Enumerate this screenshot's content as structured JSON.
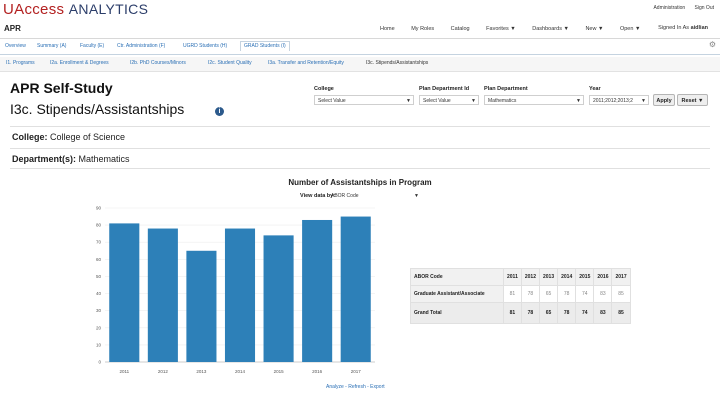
{
  "brand": {
    "u": "U",
    "access": "Access",
    "analytics": "ANALYTICS"
  },
  "top_links": [
    "Administration",
    "Sign Out"
  ],
  "app": {
    "name": "APR"
  },
  "nav": {
    "items": [
      "Home",
      "My Roles",
      "Catalog",
      "Favorites ▼",
      "Dashboards ▼",
      "New ▼",
      "Open ▼"
    ],
    "search_label": "Signed In As",
    "user": "aidlian"
  },
  "tabs": [
    "Overview",
    "Summary (A)",
    "Faculty (E)",
    "Ctr. Administration (F)",
    "UGRD Students (H)",
    "GRAD Students (I)"
  ],
  "active_tab": 5,
  "subtabs": [
    "I1. Programs",
    "I2a. Enrollment & Degrees",
    "I2b. PhD Courses/Minors",
    "I2c. Student Quality",
    "I3a. Transfer and Retention/Equity",
    "I3c. Stipends/Assistantships"
  ],
  "active_subtab": 5,
  "page": {
    "title": "APR Self-Study",
    "subtitle": "I3c. Stipends/Assistantships"
  },
  "filters": {
    "college": {
      "label": "College",
      "value": "Select Value"
    },
    "plan_dept_id": {
      "label": "Plan Department Id",
      "value": "Select Value"
    },
    "plan_dept": {
      "label": "Plan Department",
      "value": "Mathematics"
    },
    "year": {
      "label": "Year",
      "value": "2011;2012;2013;2"
    },
    "apply": "Apply",
    "reset": "Reset ▼"
  },
  "context": {
    "college_label": "College:",
    "college_value": " College of Science",
    "dept_label": "Department(s):",
    "dept_value": " Mathematics"
  },
  "chart_title": "Number of Assistantships in Program",
  "viewby": {
    "label": "View data by:",
    "value": "ABOR Code"
  },
  "chart_data": {
    "type": "bar",
    "categories": [
      "2011",
      "2012",
      "2013",
      "2014",
      "2015",
      "2016",
      "2017"
    ],
    "values": [
      81,
      78,
      65,
      78,
      74,
      83,
      85
    ],
    "ylim": [
      0,
      90
    ],
    "yticks": [
      "0",
      "10",
      "20",
      "30",
      "40",
      "50",
      "60",
      "70",
      "80",
      "90"
    ],
    "color": "#2d80b8"
  },
  "pivot": {
    "header": "ABOR Code",
    "years": [
      "2011",
      "2012",
      "2013",
      "2014",
      "2015",
      "2016",
      "2017"
    ],
    "rows": [
      {
        "label": "Graduate Assistant/Associate",
        "values": [
          "81",
          "78",
          "65",
          "78",
          "74",
          "83",
          "85"
        ]
      },
      {
        "label": "Grand Total",
        "values": [
          "81",
          "78",
          "65",
          "78",
          "74",
          "83",
          "85"
        ]
      }
    ]
  },
  "footer_links": "Analyze - Refresh - Export"
}
